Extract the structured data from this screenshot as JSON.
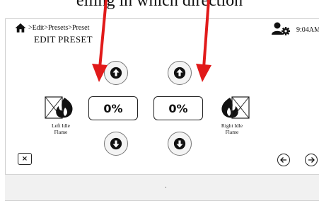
{
  "top_caption": "elling in which direction",
  "breadcrumb": ">Edit>Presets>Preset",
  "page_title": "EDIT PRESET",
  "clock": "9:04AM",
  "left_value": "0%",
  "right_value": "0%",
  "left_label": "Left Idle\nFlame",
  "right_label": "Right Idle\nFlame",
  "close_label": "×",
  "footer_text": ".",
  "icons": {
    "home": "home-icon",
    "user_settings": "user-gear-icon",
    "up": "arrow-up-icon",
    "down": "arrow-down-icon",
    "flame_left": "flame-icon",
    "flame_right": "flame-icon",
    "back": "arrow-left-icon",
    "forward": "arrow-right-icon"
  },
  "colors": {
    "annotation_arrow": "#e11a1a"
  }
}
